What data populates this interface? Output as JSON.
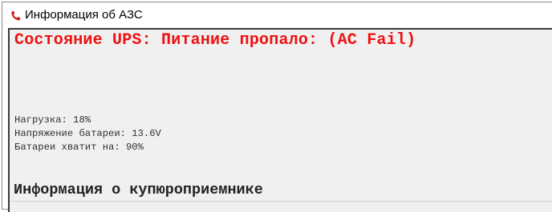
{
  "window": {
    "title": "Информация об АЗС",
    "icon": "phone-icon"
  },
  "ups": {
    "status": "Состояние UPS: Питание пропало: (AC Fail)",
    "status_color": "#ee1111",
    "load": "Нагрузка: 18%",
    "battery_voltage": "Напряжение батареи: 13.6V",
    "battery_runtime": "Батареи хватит на: 90%"
  },
  "bill_acceptor": {
    "heading": "Информация о купюроприемнике"
  }
}
